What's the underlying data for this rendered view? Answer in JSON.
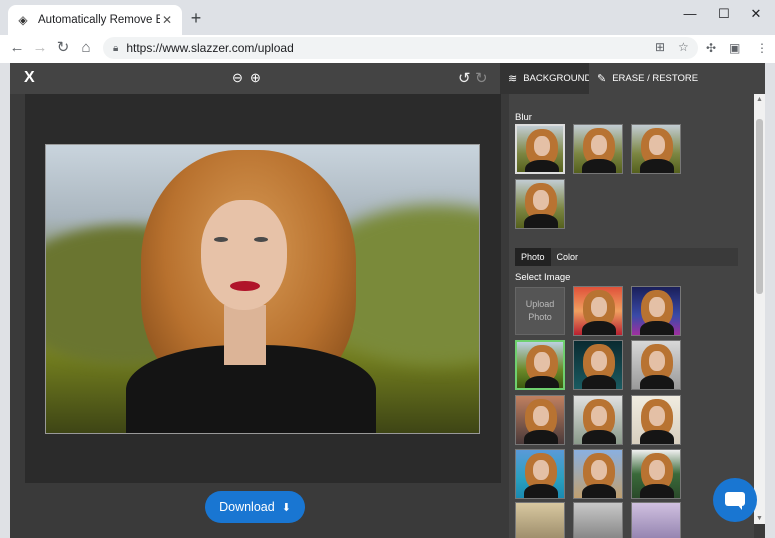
{
  "browser": {
    "tab_title": "Automatically Remove Backgro",
    "tab_close": "✕",
    "new_tab": "+",
    "url": "https://www.slazzer.com/upload",
    "win_min": "—",
    "win_max": "☐",
    "win_close": "✕"
  },
  "editor": {
    "close_label": "X",
    "tabs": {
      "background": "BACKGROUND",
      "erase": "ERASE / RESTORE"
    },
    "download_label": "Download"
  },
  "panel": {
    "blur_label": "Blur",
    "subtabs": [
      "Photo",
      "Color"
    ],
    "select_image_label": "Select Image",
    "upload_photo_label": "Upload Photo"
  },
  "colors": {
    "accent": "#1976d2",
    "panel_bg": "#444444",
    "canvas_bg": "#2b2b2b"
  }
}
